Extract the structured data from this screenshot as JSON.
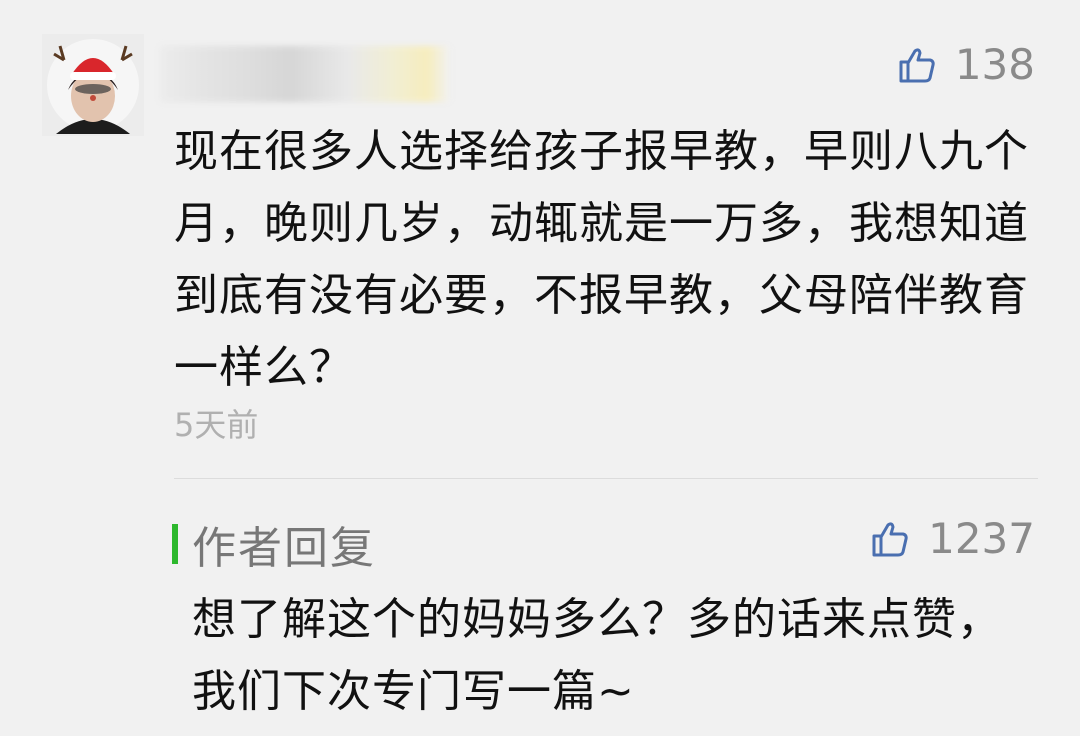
{
  "comment": {
    "likes": "138",
    "text": "现在很多人选择给孩子报早教，早则八九个月，晚则几岁，动辄就是一万多，我想知道到底有没有必要，不报早教，父母陪伴教育一样么？",
    "time": "5天前"
  },
  "reply": {
    "label": "作者回复",
    "likes": "1237",
    "text": "想了解这个的妈妈多么？多的话来点赞，我们下次专门写一篇~"
  },
  "colors": {
    "background": "#f1f1f1",
    "accent_bar": "#2db82d",
    "like_gray": "#8a8a8a"
  },
  "icons": [
    "avatar",
    "thumbs-up-icon"
  ]
}
